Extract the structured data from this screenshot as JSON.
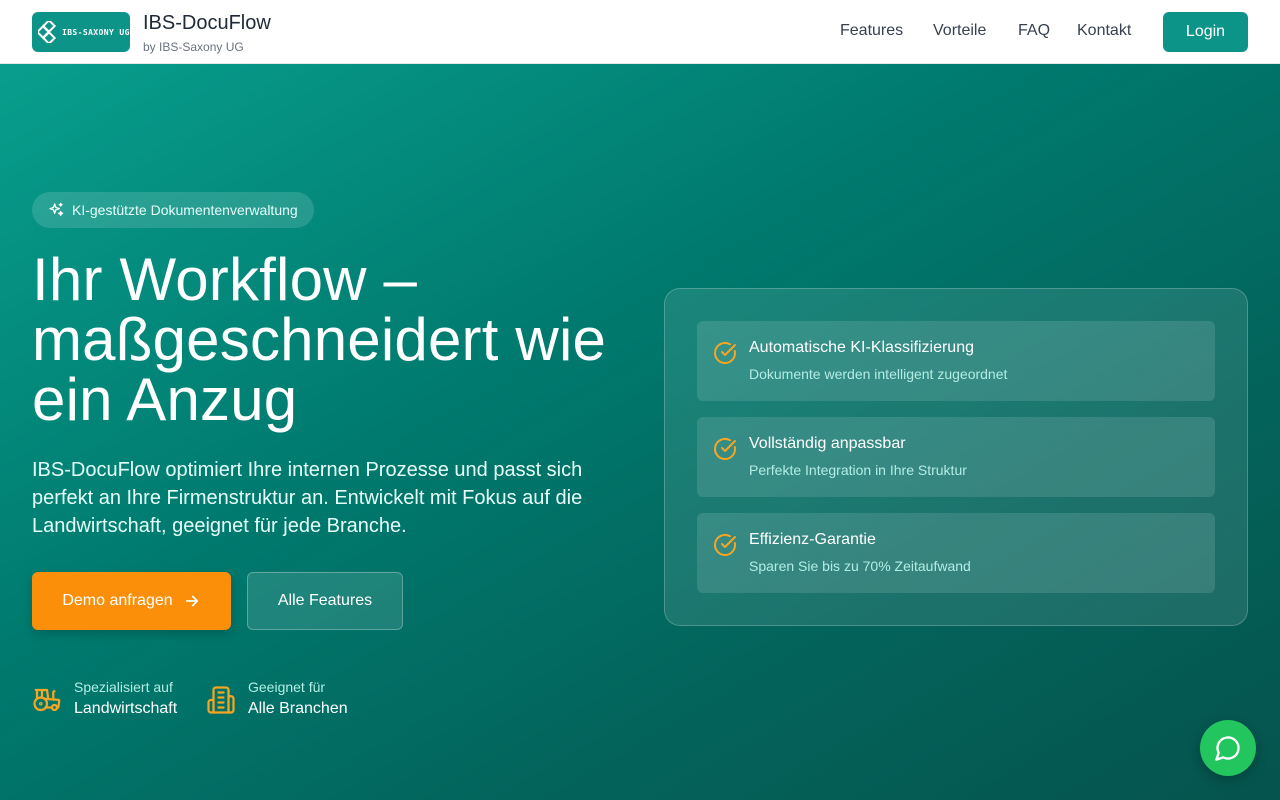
{
  "header": {
    "logo_text": "IBS-SAXONY UG",
    "brand_title": "IBS-DocuFlow",
    "brand_sub": "by IBS-Saxony UG",
    "nav": [
      "Features",
      "Vorteile",
      "FAQ",
      "Kontakt"
    ],
    "login_label": "Login"
  },
  "hero": {
    "pill_label": "KI-gestützte Dokumentenverwaltung",
    "headline_lines": [
      "Ihr Workflow –",
      "maßgeschneidert wie",
      "ein Anzug"
    ],
    "lead": "IBS-DocuFlow optimiert Ihre internen Prozesse und passt sich perfekt an Ihre Firmenstruktur an. Entwickelt mit Fokus auf die Landwirtschaft, geeignet für jede Branche.",
    "demo_label": "Demo anfragen",
    "features_label": "Alle Features",
    "stats": [
      {
        "small": "Spezialisiert auf",
        "big": "Landwirtschaft",
        "icon": "tractor-icon"
      },
      {
        "small": "Geeignet für",
        "big": "Alle Branchen",
        "icon": "building-icon"
      }
    ]
  },
  "card": {
    "items": [
      {
        "title": "Automatische KI-Klassifizierung",
        "sub": "Dokumente werden intelligent zugeordnet"
      },
      {
        "title": "Vollständig anpassbar",
        "sub": "Perfekte Integration in Ihre Struktur"
      },
      {
        "title": "Effizienz-Garantie",
        "sub": "Sparen Sie bis zu 70% Zeitaufwand"
      }
    ]
  },
  "colors": {
    "brand_teal": "#0d9488",
    "accent_orange": "#fb8f0a",
    "check_yellow": "#f5a524",
    "chat_green": "#22c55e"
  }
}
